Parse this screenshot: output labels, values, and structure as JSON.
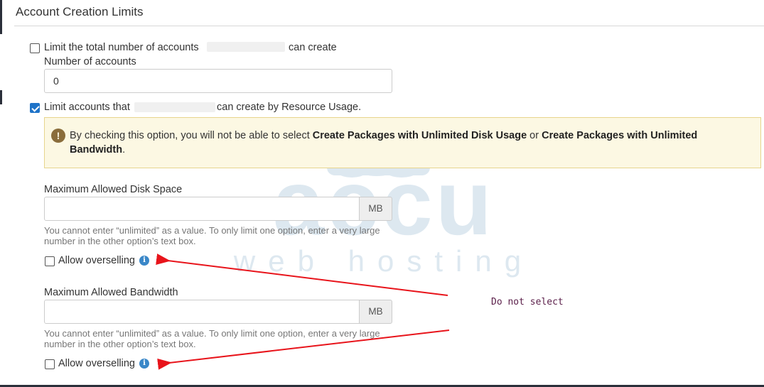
{
  "section": {
    "title": "Account Creation Limits"
  },
  "limit_total": {
    "checked": false,
    "label_before": "Limit the total number of accounts",
    "label_after": "can create",
    "field_label": "Number of accounts",
    "value": "0"
  },
  "limit_resources": {
    "checked": true,
    "label_before": "Limit accounts that",
    "label_after": "can create by Resource Usage."
  },
  "warning": {
    "icon": "exclamation-icon",
    "text_1": "By checking this option, you will not be able to select ",
    "bold_1": "Create Packages with Unlimited Disk Usage",
    "text_2": " or ",
    "bold_2": "Create Packages with Unlimited Bandwidth",
    "text_3": "."
  },
  "disk": {
    "label": "Maximum Allowed Disk Space",
    "value": "",
    "unit": "MB",
    "help": "You cannot enter “unlimited” as a value. To only limit one option, enter a very large number in the other option’s text box.",
    "overselling_label": "Allow overselling",
    "overselling_checked": false
  },
  "bandwidth": {
    "label": "Maximum Allowed Bandwidth",
    "value": "",
    "unit": "MB",
    "help": "You cannot enter “unlimited” as a value. To only limit one option, enter a very large number in the other option’s text box.",
    "overselling_label": "Allow overselling",
    "overselling_checked": false
  },
  "watermark": {
    "brand": "accu",
    "tagline": "web hosting"
  },
  "annotation": {
    "text": "Do not select",
    "color": "#e8141b"
  },
  "colors": {
    "accent": "#1e73c8",
    "warning_bg": "#fcf8e3",
    "info": "#3a87c8"
  }
}
